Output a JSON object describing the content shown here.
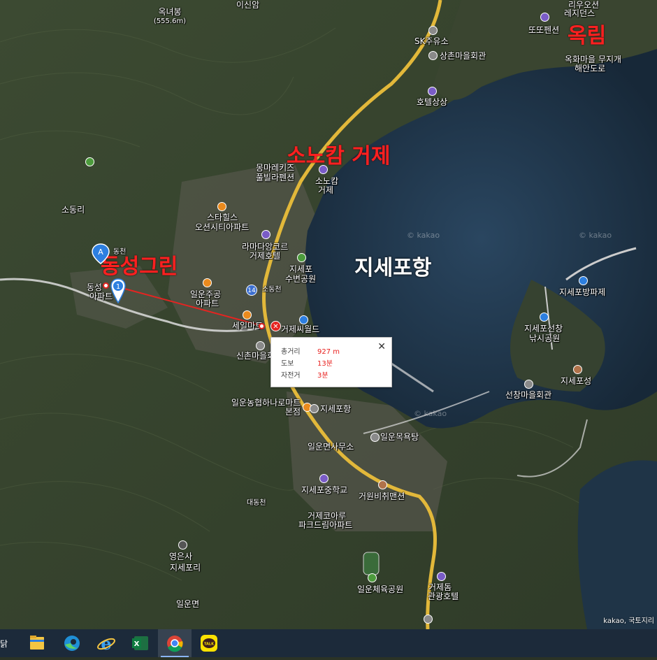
{
  "map": {
    "overlay_labels": {
      "dongseong_green": "동성그린",
      "sonocam": "소노캄 거제",
      "okrim": "옥림",
      "jisepo_harbor": "지세포항"
    },
    "places": {
      "okneobong": "옥녀봉",
      "okneobong_elev": "(555.6m)",
      "isinam": "이신암",
      "riu_ocean": "리우오션",
      "residence": "레지던스",
      "ddodo_pension": "또또펜션",
      "sk_gas": "SK주유소",
      "sangchon_hall": "상촌마을회관",
      "okhwa_rainbow": "옥화마을 무지개",
      "okhwa_coast": "해안도로",
      "hotel_sangsang": "호텔상상",
      "mongma": "몽마레키즈",
      "pool_villa": "풀빌라펜션",
      "sonocam_small1": "소노캄",
      "sonocam_small2": "거제",
      "sodong_ri": "소동리",
      "starhills1": "스타힐스",
      "starhills2": "오션시티아파트",
      "ramada1": "라마다앙코르",
      "ramada2": "거제호텔",
      "jisepo_park1": "지세포",
      "jisepo_park2": "수변공원",
      "sodong_stream": "소동천",
      "jisepo_breakwater": "지세포방파제",
      "dongseong_apt1": "동성",
      "dongseong_apt2": "아파트",
      "ilun_apt1": "일운주공",
      "ilun_apt2": "아파트",
      "seil_mart": "세일마트",
      "geoje_seaworld": "거제씨월드",
      "sinchon_hall": "신촌마을회관",
      "jisepo_dock1": "지세포선창",
      "jisepo_dock2": "낚시공원",
      "jisepo_fortress": "지세포성",
      "seonchang_hall": "선창마을회관",
      "ilun_nonghyup1": "일운농협하나로마트",
      "ilun_nonghyup2": "본점",
      "jisepo_port": "지세포항",
      "ilun_bath": "일운목욕탕",
      "ilun_office": "일운면사무소",
      "jisepo_school": "지세포중학교",
      "geowon_noodle": "거원비취맨션",
      "daedong_stream": "대동천",
      "corea_park1": "거제코아루",
      "corea_park2": "파크드림아파트",
      "yeongeunsa": "영은사",
      "jisepo_ri": "지세포리",
      "ilun_stadium": "일운체육공원",
      "geojedo_hotel1": "거제돔",
      "geojedo_hotel2": "관광호텔",
      "ilun_myeon": "일운면",
      "route_14": "14",
      "dong_small": "동천",
      "kakao_wm": "© kakao"
    },
    "attribution": "kakao, 국토지리",
    "marker_a": "A",
    "marker_1": "1"
  },
  "popup": {
    "rows": [
      {
        "key": "총거리",
        "value": "927 m"
      },
      {
        "key": "도보",
        "value": "13분"
      },
      {
        "key": "자전거",
        "value": "3분"
      }
    ],
    "close": "✕"
  },
  "taskbar": {
    "edge_text": "닭",
    "items": [
      "file-explorer",
      "edge",
      "internet-explorer",
      "excel",
      "chrome",
      "kakaotalk"
    ],
    "excel_letter": "X",
    "kakao_letter": "TALK"
  },
  "colors": {
    "sea": "#1f3447",
    "land": "#3a4530",
    "road": "#e2b83a",
    "route_line": "#e52421",
    "overlay_red": "#ff2020"
  }
}
